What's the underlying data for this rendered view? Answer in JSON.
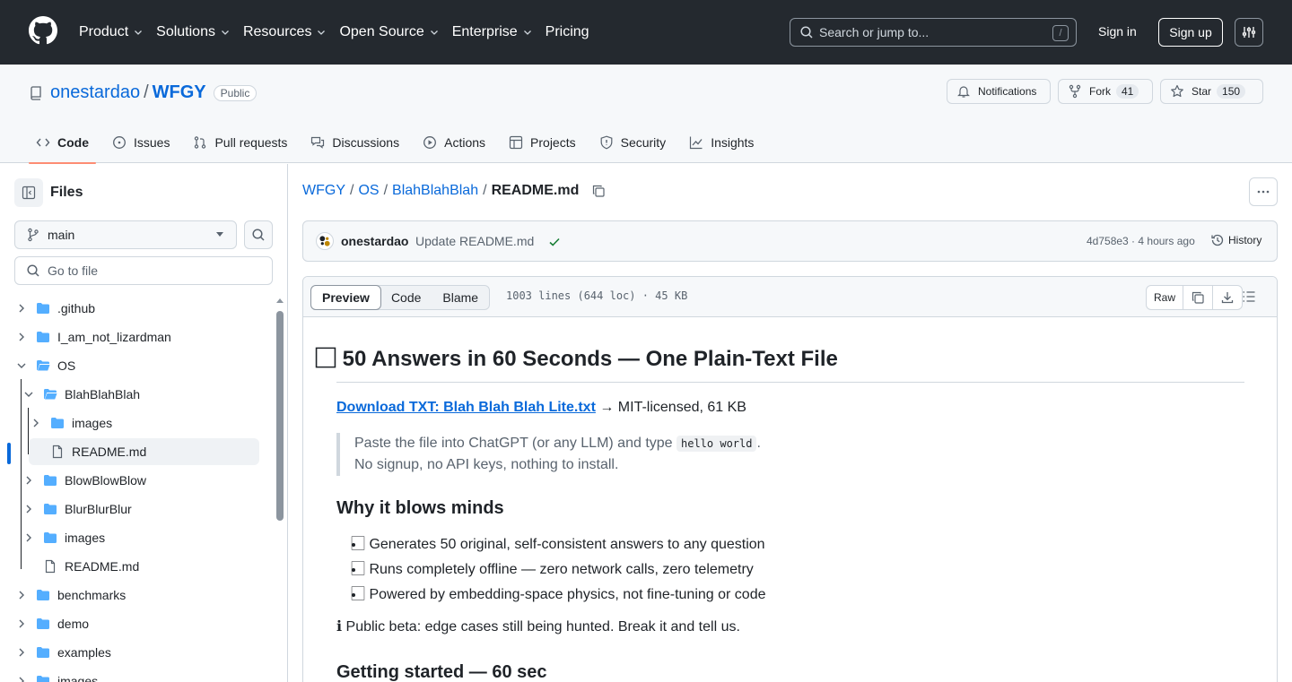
{
  "header": {
    "nav": [
      "Product",
      "Solutions",
      "Resources",
      "Open Source",
      "Enterprise",
      "Pricing"
    ],
    "nav_dropdown": [
      true,
      true,
      true,
      true,
      true,
      false
    ],
    "search_placeholder": "Search or jump to...",
    "search_shortcut": "/",
    "sign_in": "Sign in",
    "sign_up": "Sign up"
  },
  "repo": {
    "owner": "onestardao",
    "separator": "/",
    "name": "WFGY",
    "visibility": "Public",
    "notifications": "Notifications",
    "fork_label": "Fork",
    "fork_count": "41",
    "star_label": "Star",
    "star_count": "150"
  },
  "tabs": [
    {
      "label": "Code",
      "icon": "code-icon",
      "active": true
    },
    {
      "label": "Issues",
      "icon": "issue-icon"
    },
    {
      "label": "Pull requests",
      "icon": "pull-request-icon"
    },
    {
      "label": "Discussions",
      "icon": "discussion-icon"
    },
    {
      "label": "Actions",
      "icon": "play-icon"
    },
    {
      "label": "Projects",
      "icon": "table-icon"
    },
    {
      "label": "Security",
      "icon": "shield-icon"
    },
    {
      "label": "Insights",
      "icon": "graph-icon"
    }
  ],
  "sidebar": {
    "title": "Files",
    "branch": "main",
    "goto_placeholder": "Go to file",
    "tree": [
      {
        "label": ".github",
        "type": "folder",
        "expanded": false,
        "depth": 0
      },
      {
        "label": "I_am_not_lizardman",
        "type": "folder",
        "expanded": false,
        "depth": 0
      },
      {
        "label": "OS",
        "type": "folder",
        "expanded": true,
        "depth": 0
      },
      {
        "label": "BlahBlahBlah",
        "type": "folder",
        "expanded": true,
        "depth": 1
      },
      {
        "label": "images",
        "type": "folder",
        "expanded": false,
        "depth": 2
      },
      {
        "label": "README.md",
        "type": "file",
        "depth": 2,
        "selected": true
      },
      {
        "label": "BlowBlowBlow",
        "type": "folder",
        "expanded": false,
        "depth": 1
      },
      {
        "label": "BlurBlurBlur",
        "type": "folder",
        "expanded": false,
        "depth": 1
      },
      {
        "label": "images",
        "type": "folder",
        "expanded": false,
        "depth": 1
      },
      {
        "label": "README.md",
        "type": "file",
        "depth": 1
      },
      {
        "label": "benchmarks",
        "type": "folder",
        "expanded": false,
        "depth": 0
      },
      {
        "label": "demo",
        "type": "folder",
        "expanded": false,
        "depth": 0
      },
      {
        "label": "examples",
        "type": "folder",
        "expanded": false,
        "depth": 0
      },
      {
        "label": "images",
        "type": "folder",
        "expanded": false,
        "depth": 0
      }
    ]
  },
  "breadcrumb": {
    "parts": [
      "WFGY",
      "OS",
      "BlahBlahBlah"
    ],
    "separator": "/",
    "current": "README.md"
  },
  "commit": {
    "author": "onestardao",
    "message": "Update README.md",
    "meta": "4d758e3 · 4 hours ago",
    "history": "History"
  },
  "file": {
    "views": [
      "Preview",
      "Code",
      "Blame"
    ],
    "active_view": "Preview",
    "info": "1003 lines (644 loc) · 45 KB",
    "raw": "Raw"
  },
  "readme": {
    "h1": "⃞ 50 Answers in 60 Seconds — One Plain-Text File",
    "download_link": "Download TXT: Blah Blah Blah Lite.txt",
    "download_suffix": " → MIT-licensed, 61 KB",
    "quote_line1_pre": "Paste the file into ChatGPT (or any LLM) and type ",
    "quote_code": "hello world",
    "quote_line1_post": ".",
    "quote_line2": "No signup, no API keys, nothing to install.",
    "h2_why": "Why it blows minds",
    "bullets": [
      "⃞ Generates 50 original, self-consistent answers to any question",
      "⃞ Runs completely offline — zero network calls, zero telemetry",
      "⃞ Powered by embedding-space physics, not fine-tuning or code"
    ],
    "note": "ℹ Public beta: edge cases still being hunted. Break it and tell us.",
    "h2_start": "Getting started — 60 sec"
  },
  "colors": {
    "header_bg": "#24292f",
    "link": "#0969da",
    "tab_underline": "#fd8c73",
    "folder": "#54aeff",
    "success": "#1a7f37"
  }
}
